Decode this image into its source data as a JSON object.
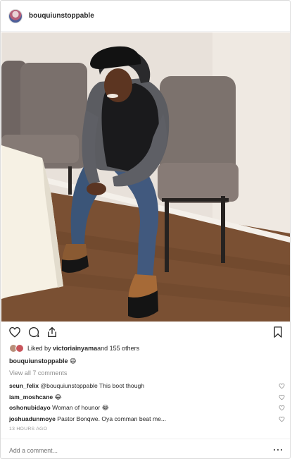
{
  "post": {
    "username": "bouquiunstoppable",
    "photo_icon": "photo-of-seated-person",
    "liked_by_prefix": "Liked by ",
    "liked_by_user": "victoriainyama",
    "liked_by_suffix": " and 155 others",
    "caption_user": "bouquiunstoppable",
    "caption_text": " 😄",
    "view_all_comments": "View all 7 comments",
    "comments": [
      {
        "user": "seun_felix",
        "text": " @bouquiunstoppable This boot though"
      },
      {
        "user": "iam_moshcane",
        "text": " 😂"
      },
      {
        "user": "oshonubidayo",
        "text": " Woman of hounor 😂"
      },
      {
        "user": "joshuadunmoye",
        "text": " Pastor Bonqwe. Oya comman beat me..."
      }
    ],
    "timestamp": "13 HOURS AGO",
    "add_comment_placeholder": "Add a comment..."
  },
  "icons": {
    "like": "heart-icon",
    "comment": "comment-icon",
    "share": "share-icon",
    "save": "bookmark-icon",
    "comment_like": "small-heart-icon",
    "more": "more-options-icon"
  },
  "colors": {
    "text": "#262626",
    "muted": "#8e8e8e",
    "border": "#dbdbdb"
  }
}
